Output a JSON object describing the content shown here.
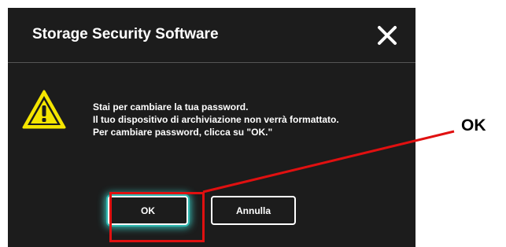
{
  "dialog": {
    "title": "Storage Security Software",
    "message_lines": [
      "Stai per cambiare la tua password.",
      "Il tuo dispositivo di archiviazione non verrà formattato.",
      "Per cambiare password, clicca su \"OK.\""
    ],
    "buttons": {
      "ok_label": "OK",
      "cancel_label": "Annulla"
    }
  },
  "annotation": {
    "label": "OK",
    "color": "#e01010"
  },
  "colors": {
    "dialog_bg": "#1c1c1c",
    "warning_yellow": "#f5e600",
    "focus_glow": "#3ad0c8"
  },
  "icons": {
    "close": "close-icon",
    "warning": "warning-icon"
  }
}
